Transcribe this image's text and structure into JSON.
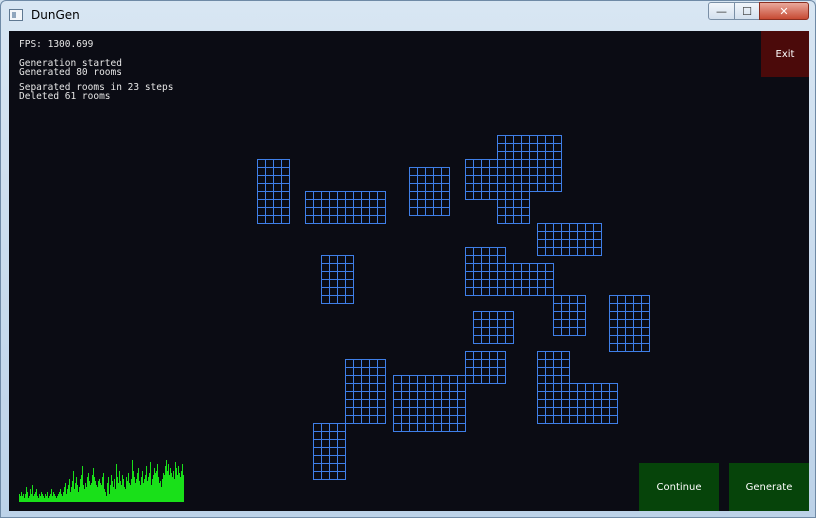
{
  "window": {
    "title": "DunGen",
    "controls": {
      "minimize": "—",
      "maximize": "☐",
      "close": "✕"
    }
  },
  "hud": {
    "fps": "FPS: 1300.699",
    "log": [
      "Generation started",
      "Generated 80 rooms",
      "Separated rooms in 23 steps",
      "Deleted 61 rooms"
    ]
  },
  "buttons": {
    "exit": "Exit",
    "continue": "Continue",
    "generate": "Generate"
  },
  "colors": {
    "background": "#0b0c14",
    "room_grid": "#3f7fe8",
    "exit_bg": "#4b0a0a",
    "action_bg": "#06440a",
    "graph": "#19e019"
  },
  "rooms": [
    {
      "col": 31,
      "row": 16,
      "w": 4,
      "h": 8
    },
    {
      "col": 37,
      "row": 20,
      "w": 10,
      "h": 4
    },
    {
      "col": 50,
      "row": 17,
      "w": 5,
      "h": 6
    },
    {
      "col": 57,
      "row": 16,
      "w": 4,
      "h": 5
    },
    {
      "col": 61,
      "row": 13,
      "w": 8,
      "h": 7
    },
    {
      "col": 61,
      "row": 20,
      "w": 4,
      "h": 4
    },
    {
      "col": 66,
      "row": 24,
      "w": 8,
      "h": 4
    },
    {
      "col": 39,
      "row": 28,
      "w": 4,
      "h": 6
    },
    {
      "col": 57,
      "row": 27,
      "w": 5,
      "h": 6
    },
    {
      "col": 62,
      "row": 29,
      "w": 6,
      "h": 4
    },
    {
      "col": 68,
      "row": 33,
      "w": 4,
      "h": 5
    },
    {
      "col": 75,
      "row": 33,
      "w": 5,
      "h": 7
    },
    {
      "col": 58,
      "row": 35,
      "w": 5,
      "h": 4
    },
    {
      "col": 57,
      "row": 40,
      "w": 5,
      "h": 4
    },
    {
      "col": 66,
      "row": 40,
      "w": 4,
      "h": 9
    },
    {
      "col": 70,
      "row": 44,
      "w": 6,
      "h": 5
    },
    {
      "col": 42,
      "row": 41,
      "w": 5,
      "h": 8
    },
    {
      "col": 48,
      "row": 43,
      "w": 9,
      "h": 7
    },
    {
      "col": 38,
      "row": 49,
      "w": 4,
      "h": 7
    }
  ],
  "graph_samples": [
    4,
    3,
    5,
    3,
    4,
    2,
    4,
    7,
    5,
    2,
    3,
    6,
    4,
    8,
    3,
    4,
    5,
    6,
    3,
    2,
    4,
    3,
    5,
    4,
    3,
    2,
    4,
    3,
    5,
    2,
    3,
    4,
    6,
    3,
    5,
    4,
    3,
    2,
    3,
    4,
    5,
    6,
    4,
    3,
    5,
    7,
    9,
    4,
    6,
    8,
    11,
    5,
    7,
    10,
    15,
    6,
    9,
    12,
    8,
    5,
    7,
    11,
    13,
    17,
    8,
    6,
    9,
    7,
    12,
    14,
    10,
    8,
    9,
    13,
    16,
    12,
    10,
    8,
    7,
    10,
    11,
    9,
    8,
    12,
    14,
    6,
    5,
    3,
    9,
    12,
    4,
    8,
    13,
    10,
    7,
    11,
    6,
    18,
    12,
    9,
    15,
    10,
    8,
    13,
    11,
    7,
    6,
    12,
    10,
    14,
    9,
    8,
    11,
    20,
    15,
    12,
    9,
    11,
    14,
    16,
    10,
    8,
    12,
    15,
    9,
    11,
    13,
    17,
    10,
    12,
    14,
    19,
    8,
    11,
    13,
    16,
    14,
    15,
    18,
    12,
    9,
    10,
    7,
    11,
    14,
    13,
    17,
    20,
    15,
    18,
    13,
    16,
    14,
    12,
    15,
    11,
    19,
    16,
    13,
    17,
    14,
    12,
    15,
    18,
    13,
    11
  ]
}
